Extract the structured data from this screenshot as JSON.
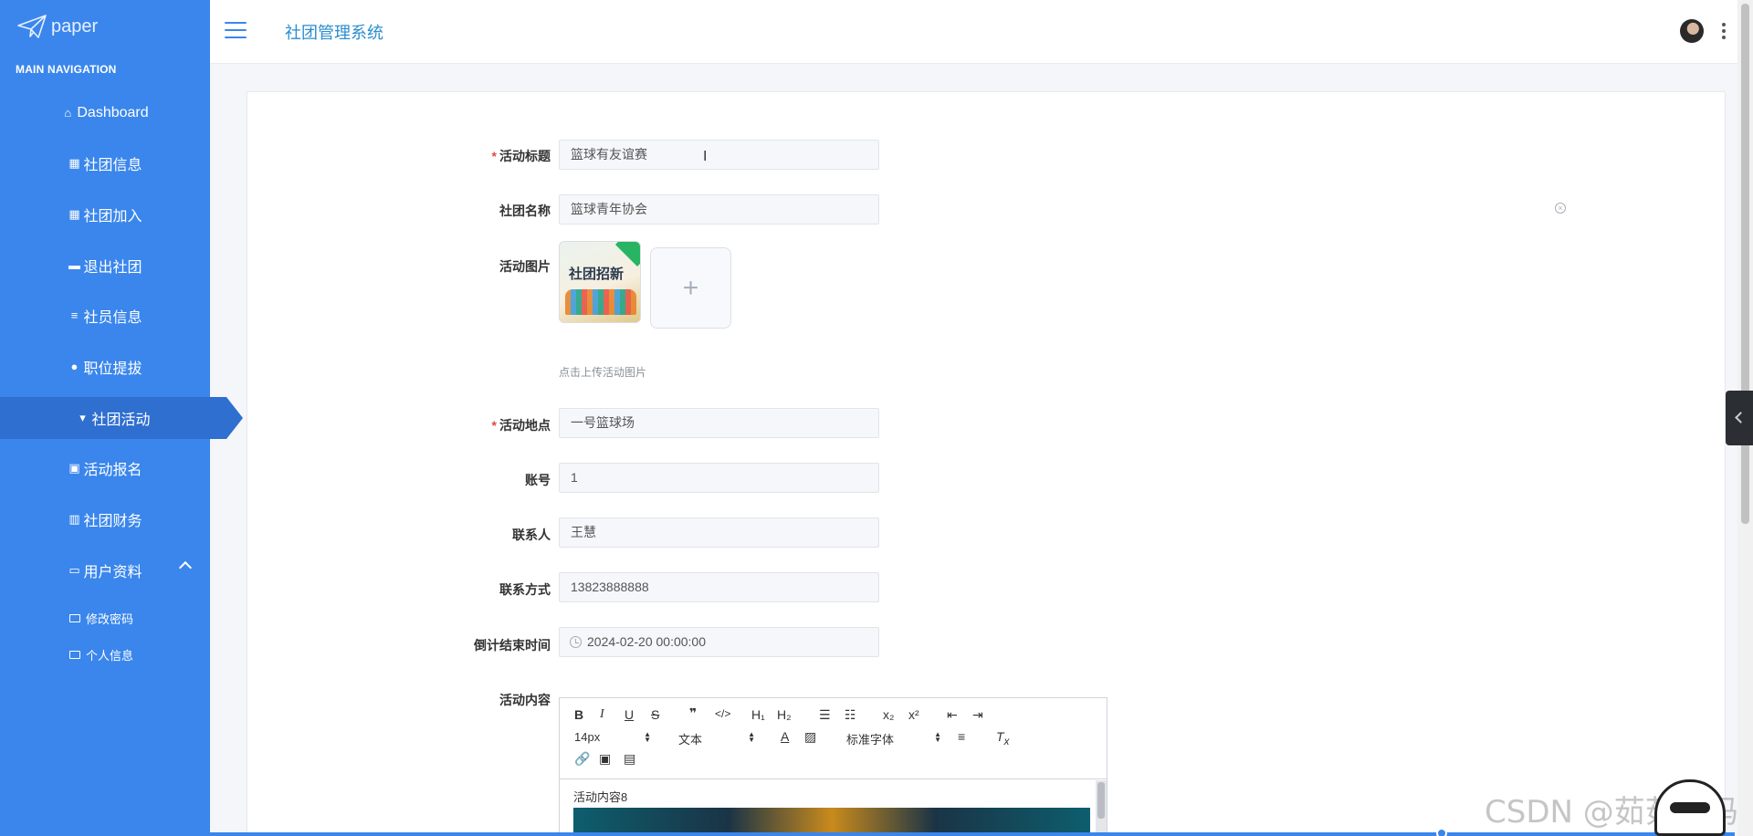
{
  "brand": {
    "name": "paper"
  },
  "sidebar": {
    "header": "MAIN NAVIGATION",
    "items": [
      {
        "label": "Dashboard",
        "icon": "home-icon"
      },
      {
        "label": "社团信息",
        "icon": "grid-icon"
      },
      {
        "label": "社团加入",
        "icon": "grid-icon"
      },
      {
        "label": "退出社团",
        "icon": "briefcase-icon"
      },
      {
        "label": "社员信息",
        "icon": "list-icon"
      },
      {
        "label": "职位提拔",
        "icon": "location-icon"
      },
      {
        "label": "社团活动",
        "icon": "flag-icon",
        "active": true
      },
      {
        "label": "活动报名",
        "icon": "clipboard-icon"
      },
      {
        "label": "社团财务",
        "icon": "bar-chart-icon"
      },
      {
        "label": "用户资料",
        "icon": "card-icon",
        "expanded": true
      }
    ],
    "subitems": [
      {
        "label": "修改密码",
        "icon": "folder-icon"
      },
      {
        "label": "个人信息",
        "icon": "folder-icon"
      }
    ]
  },
  "header": {
    "title": "社团管理系统"
  },
  "form": {
    "title_label": "活动标题",
    "title_value": "篮球有友谊赛",
    "club_label": "社团名称",
    "club_value": "篮球青年协会",
    "image_label": "活动图片",
    "image_thumb_text": "社团招新",
    "upload_plus": "+",
    "upload_hint": "点击上传活动图片",
    "location_label": "活动地点",
    "location_value": "一号篮球场",
    "account_label": "账号",
    "account_value": "1",
    "contact_label": "联系人",
    "contact_value": "王慧",
    "phone_label": "联系方式",
    "phone_value": "13823888888",
    "deadline_label": "倒计结束时间",
    "deadline_value": "2024-02-20 00:00:00",
    "content_label": "活动内容"
  },
  "editor": {
    "font_size": "14px",
    "paragraph": "文本",
    "font_family": "标准字体",
    "content_text": "活动内容8"
  },
  "watermark": "CSDN @茹茹妈妈",
  "colors": {
    "sidebar": "#3a86ec",
    "active": "#2f6fd0",
    "title": "#2b8ecf",
    "required": "#e34848"
  }
}
